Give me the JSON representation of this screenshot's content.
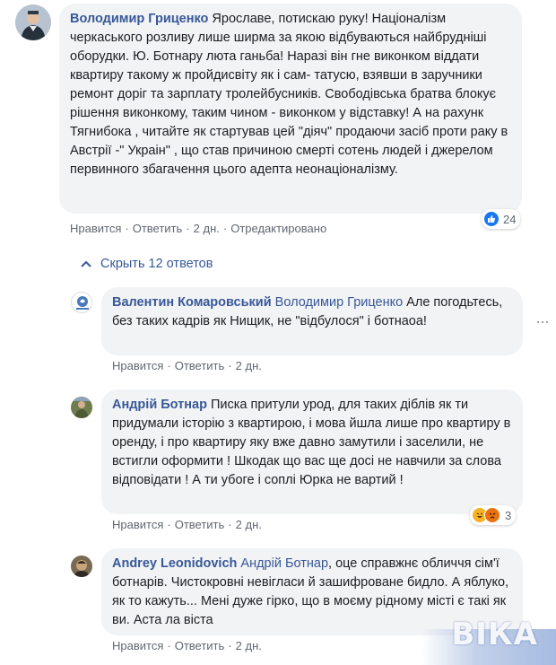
{
  "comments": [
    {
      "author": "Володимир Гриценко",
      "text": " Ярославе, потискаю руку! Націоналізм черкаського розливу лише ширма за якою відбуваються найбрудніші оборудки. Ю. Ботнару люта ганьба! Наразі він гне виконком віддати квартиру такому ж пройдисвіту як і сам- татусю, взявши в заручники ремонт доріг та зарплату тролейбусників. Свободівська братва блокує рішення виконкому, таким чином - виконком у відставку! А на рахунк Тягнибока , читайте як стартував цей \"діяч\" продаючи засіб проти раку в Австрії -\" Украін\" , що став причиною смерті сотень людей і джерелом первинного збагачення цього адепта неонаціоналізму.",
      "like": "Нравится",
      "reply": "Ответить",
      "time": "2 дн.",
      "edited": "Отредактировано",
      "reaction_count": "24",
      "reaction_icons": [
        "like-icon"
      ]
    }
  ],
  "collapse_label": "Скрыть 12 ответов",
  "replies": [
    {
      "author": "Валентин Комаровський",
      "mention": "Володимир Гриценко",
      "text": " Але погодьтесь, без таких кадрів як Нищик, не \"відбулося\" і ботнаоа!",
      "like": "Нравится",
      "reply": "Ответить",
      "time": "2 дн."
    },
    {
      "author": "Андрій Ботнар",
      "mention": "",
      "text": " Писка притули урод, для таких діблів як ти придумали історію з квартирою, і мова йшла лише про квартиру в оренду, і про квартиру яку вже давно замутили і заселили, не встигли оформити ! Шкодак що вас ще досі не навчили за слова відповідати ! А ти убоге і соплі Юрка не вартий !",
      "like": "Нравится",
      "reply": "Ответить",
      "time": "2 дн.",
      "reaction_count": "3",
      "reaction_icons": [
        "haha-icon",
        "angry-icon"
      ]
    },
    {
      "author": "Andrey Leonidovich",
      "mention": "Андрій Ботнар",
      "text": ", оце справжнє обличчя сім'ї ботнарів. Чистокровні невігласи й зашифроване бидло. А яблуко, як то кажуть... Мені дуже гірко, що в моєму рідному місті є такі як ви. Аста ла віста",
      "like": "Нравится",
      "reply": "Ответить",
      "time": "2 дн."
    }
  ],
  "watermark": "ВІКА",
  "colors": {
    "link": "#385898",
    "bubble": "#f2f3f5",
    "meta": "#606770",
    "like": "#1877f2",
    "haha": "#f7b125",
    "angry": "#e9710f"
  }
}
